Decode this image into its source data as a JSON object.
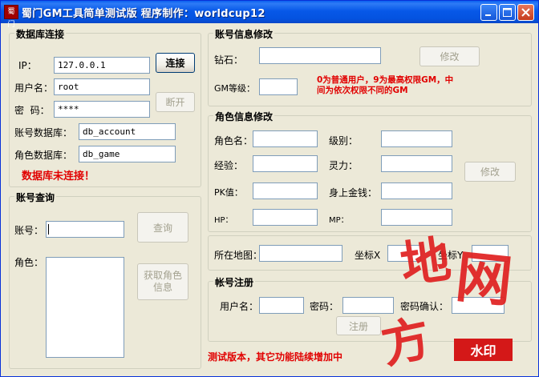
{
  "window": {
    "title": "蜀门GM工具简单测试版  程序制作：worldcup12",
    "icon_text": "蜀门",
    "accent_color": "#0a5ff0"
  },
  "db": {
    "title": "数据库连接",
    "ip_label": "IP：",
    "ip_value": "127.0.0.1",
    "user_label": "用户名：",
    "user_value": "root",
    "pwd_label": "密  码：",
    "pwd_value": "****",
    "account_db_label": "账号数据库：",
    "account_db_value": "db_account",
    "role_db_label": "角色数据库：",
    "role_db_value": "db_game",
    "connect_button": "连接",
    "disconnect_button": "断开",
    "status": "数据库未连接！",
    "status_color": "#e10000"
  },
  "query": {
    "title": "账号查询",
    "account_label": "账号：",
    "account_value": "",
    "role_label": "角色：",
    "query_button": "查询",
    "get_role_button_line1": "获取角色",
    "get_role_button_line2": "信息"
  },
  "account_edit": {
    "title": "账号信息修改",
    "diamond_label": "钻石：",
    "diamond_value": "",
    "gm_label": "GM等级：",
    "gm_value": "",
    "modify_button": "修改",
    "note_line1": "0为普通用户，9为最高权限GM，中",
    "note_line2": "间为依次权限不同的GM"
  },
  "role_edit": {
    "title": "角色信息修改",
    "name_label": "角色名：",
    "level_label": "级别：",
    "exp_label": "经验：",
    "spirit_label": "灵力：",
    "pk_label": "PK值：",
    "money_label": "身上金钱：",
    "hp_label": "HP：",
    "mp_label": "MP：",
    "modify_button": "修改",
    "map_label": "所在地图：",
    "x_label": "坐标X",
    "y_label": "坐标Y"
  },
  "register": {
    "title": "帐号注册",
    "user_label": "用户名：",
    "pwd_label": "密码：",
    "confirm_label": "密码确认：",
    "register_button": "注册"
  },
  "footer_note": "测试版本，其它功能陆续增加中",
  "watermark": {
    "chars": [
      "地",
      "网",
      "方"
    ],
    "badge": "水印",
    "color": "#e02020"
  }
}
